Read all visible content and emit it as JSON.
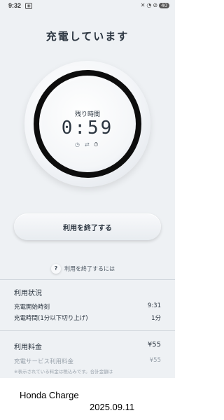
{
  "status_bar": {
    "time": "9:32",
    "battery": "40",
    "icons": [
      "record-icon",
      "mute-icon",
      "wifi-icon",
      "dnd-icon",
      "battery-icon"
    ]
  },
  "screen": {
    "title": "充電しています",
    "remaining_label": "残り時間",
    "remaining_time": "0:59",
    "end_button_label": "利用を終了する",
    "help_icon": "?",
    "help_label": "利用を終了するには"
  },
  "usage": {
    "title": "利用状況",
    "rows": [
      {
        "label": "充電開始時刻",
        "value": "9:31"
      },
      {
        "label": "充電時間(1分以下切り上げ)",
        "value": "1分"
      }
    ]
  },
  "fees": {
    "title": "利用料金",
    "total": "¥55",
    "rows": [
      {
        "label": "充電サービス利用料金",
        "value": "¥55"
      }
    ],
    "note": "※表示されている料金は税込みです。合計金額は"
  },
  "nav": {
    "recent": "|||",
    "home": "○",
    "back": "<"
  },
  "caption": {
    "title": "Honda Charge",
    "date": "2025.09.11"
  },
  "colors": {
    "background": "#eef1f4",
    "text": "#2b3540",
    "ring": "#0d0d0d"
  }
}
